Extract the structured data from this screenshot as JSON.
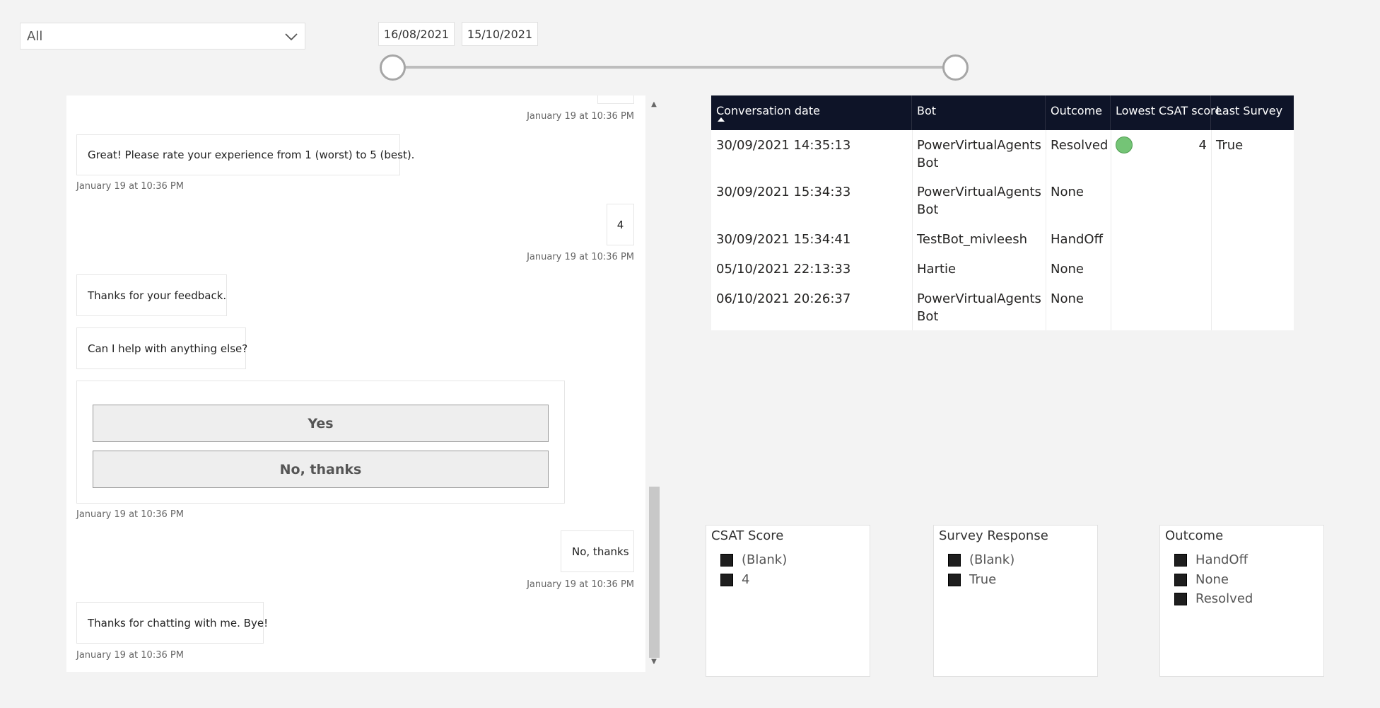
{
  "filters": {
    "dropdown_value": "All",
    "date_start": "16/08/2021",
    "date_end": "15/10/2021"
  },
  "chat": {
    "messages": [
      {
        "from": "user",
        "text": "",
        "time": "January 19 at 10:36 PM"
      },
      {
        "from": "bot",
        "text": "Great! Please rate your experience from 1 (worst) to 5 (best).",
        "time": "January 19 at 10:36 PM"
      },
      {
        "from": "user",
        "text": "4",
        "time": "January 19 at 10:36 PM"
      },
      {
        "from": "bot",
        "text": "Thanks for your feedback."
      },
      {
        "from": "bot",
        "text": "Can I help with anything else?"
      },
      {
        "from": "bot",
        "type": "card",
        "buttons": [
          "Yes",
          "No, thanks"
        ],
        "time": "January 19 at 10:36 PM"
      },
      {
        "from": "user",
        "text": "No, thanks",
        "time": "January 19 at 10:36 PM"
      },
      {
        "from": "bot",
        "text": "Thanks for chatting with me. Bye!",
        "time": "January 19 at 10:36 PM"
      }
    ]
  },
  "table": {
    "headers": [
      "Conversation date",
      "Bot",
      "Outcome",
      "Lowest CSAT score",
      "Last Survey"
    ],
    "rows": [
      {
        "date": "30/09/2021 14:35:13",
        "bot_line1": "PowerVirtualAgents",
        "bot_line2": "Bot",
        "outcome": "Resolved",
        "csat": "4",
        "survey": "True"
      },
      {
        "date": "30/09/2021 15:34:33",
        "bot_line1": "PowerVirtualAgents",
        "bot_line2": "Bot",
        "outcome": "None",
        "csat": "",
        "survey": ""
      },
      {
        "date": "30/09/2021 15:34:41",
        "bot_line1": "TestBot_mivleesh",
        "bot_line2": "",
        "outcome": "HandOff",
        "csat": "",
        "survey": ""
      },
      {
        "date": "05/10/2021 22:13:33",
        "bot_line1": "Hartie",
        "bot_line2": "",
        "outcome": "None",
        "csat": "",
        "survey": ""
      },
      {
        "date": "06/10/2021 20:26:37",
        "bot_line1": "PowerVirtualAgents",
        "bot_line2": "Bot",
        "outcome": "None",
        "csat": "",
        "survey": ""
      }
    ]
  },
  "slicers": [
    {
      "title": "CSAT Score",
      "items": [
        "(Blank)",
        "4"
      ]
    },
    {
      "title": "Survey Response",
      "items": [
        "(Blank)",
        "True"
      ]
    },
    {
      "title": "Outcome",
      "items": [
        "HandOff",
        "None",
        "Resolved"
      ]
    }
  ],
  "colors": {
    "table_header_bg": "#0e1428",
    "csat_indicator": "#74c476",
    "page_bg": "#f3f3f3"
  },
  "icons": {
    "dropdown": "chevron-down-icon",
    "sort": "sort-ascending-icon",
    "checkbox": "checkbox-icon"
  }
}
